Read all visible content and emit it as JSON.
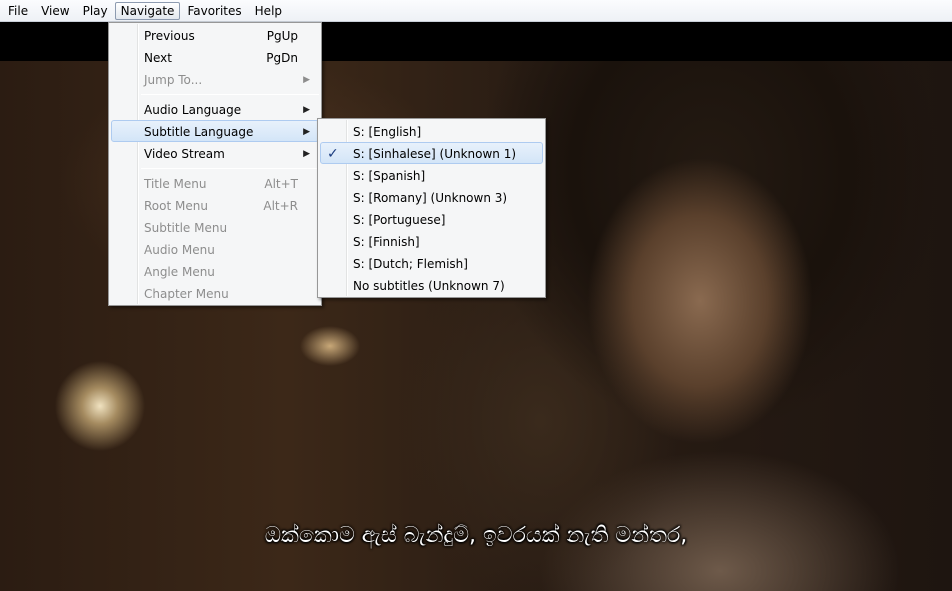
{
  "menubar": {
    "items": [
      "File",
      "View",
      "Play",
      "Navigate",
      "Favorites",
      "Help"
    ],
    "active": "Navigate"
  },
  "navigate_menu": {
    "items": [
      {
        "label": "Previous",
        "shortcut": "PgUp",
        "disabled": false
      },
      {
        "label": "Next",
        "shortcut": "PgDn",
        "disabled": false
      },
      {
        "label": "Jump To...",
        "submenu": true,
        "disabled": true
      },
      {
        "label": "Audio Language",
        "submenu": true,
        "disabled": false
      },
      {
        "label": "Subtitle Language",
        "submenu": true,
        "disabled": false,
        "highlighted": true
      },
      {
        "label": "Video Stream",
        "submenu": true,
        "disabled": false
      },
      {
        "label": "Title Menu",
        "shortcut": "Alt+T",
        "disabled": true
      },
      {
        "label": "Root Menu",
        "shortcut": "Alt+R",
        "disabled": true
      },
      {
        "label": "Subtitle Menu",
        "disabled": true
      },
      {
        "label": "Audio Menu",
        "disabled": true
      },
      {
        "label": "Angle Menu",
        "disabled": true
      },
      {
        "label": "Chapter Menu",
        "disabled": true
      }
    ]
  },
  "subtitle_menu": {
    "items": [
      {
        "label": "S: [English]",
        "checked": false
      },
      {
        "label": "S: [Sinhalese] (Unknown 1)",
        "checked": true
      },
      {
        "label": "S: [Spanish]",
        "checked": false
      },
      {
        "label": "S: [Romany] (Unknown 3)",
        "checked": false
      },
      {
        "label": "S: [Portuguese]",
        "checked": false
      },
      {
        "label": "S: [Finnish]",
        "checked": false
      },
      {
        "label": "S: [Dutch; Flemish]",
        "checked": false
      },
      {
        "label": "No subtitles (Unknown 7)",
        "checked": false
      }
    ],
    "check_glyph": "✓"
  },
  "glyphs": {
    "submenu_arrow": "▶"
  },
  "video": {
    "subtitle_text": "ඔක්කොම ඇස් බැන්දුම්, ඉවරයක් නැති මන්තර,"
  },
  "colors": {
    "highlight": "#d3e5f8",
    "disabled_text": "#8d8d8d",
    "check": "#1b3d80"
  }
}
